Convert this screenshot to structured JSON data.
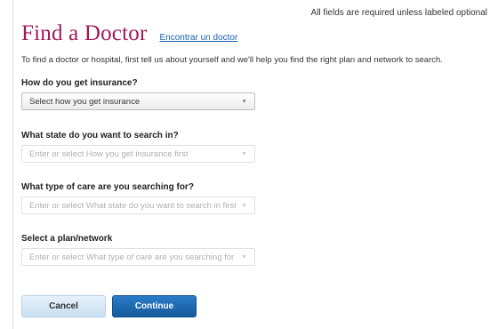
{
  "header": {
    "required_note": "All fields are required unless labeled optional",
    "title": "Find a Doctor",
    "spanish_link": "Encontrar un doctor"
  },
  "intro_text": "To find a doctor or hospital, first tell us about yourself and we'll help you find the right plan and network to search.",
  "fields": [
    {
      "label": "How do you get insurance?",
      "value": "Select how you get insurance",
      "enabled": true
    },
    {
      "label": "What state do you want to search in?",
      "value": "Enter or select How you get insurance first",
      "enabled": false
    },
    {
      "label": "What type of care are you searching for?",
      "value": "Enter or select What state do you want to search in first",
      "enabled": false
    },
    {
      "label": "Select a plan/network",
      "value": "Enter or select What type of care are you searching for first",
      "enabled": false
    }
  ],
  "buttons": {
    "cancel": "Cancel",
    "continue": "Continue"
  },
  "icons": {
    "dropdown": "chevron-down-icon"
  },
  "colors": {
    "title": "#a0195c",
    "link": "#1a5fb0",
    "primary_button": "#1d6bb3"
  }
}
